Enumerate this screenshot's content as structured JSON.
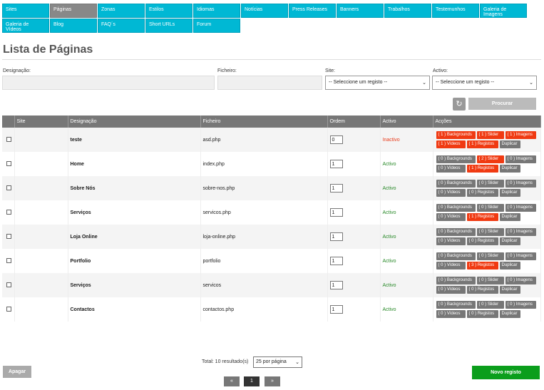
{
  "nav": {
    "tabs": [
      {
        "label": "Sites",
        "active": false
      },
      {
        "label": "Páginas",
        "active": true
      },
      {
        "label": "Zonas",
        "active": false
      },
      {
        "label": "Estilos",
        "active": false
      },
      {
        "label": "Idiomas",
        "active": false
      },
      {
        "label": "Notícias",
        "active": false
      },
      {
        "label": "Press Releases",
        "active": false
      },
      {
        "label": "Banners",
        "active": false
      },
      {
        "label": "Trabalhos",
        "active": false
      },
      {
        "label": "Testemunhos",
        "active": false
      },
      {
        "label": "Galeria de Imagens",
        "active": false
      },
      {
        "label": "Galeria de Vídeos",
        "active": false
      },
      {
        "label": "Blog",
        "active": false
      },
      {
        "label": "FAQ´s",
        "active": false
      },
      {
        "label": "Short URLs",
        "active": false
      },
      {
        "label": "Forum",
        "active": false
      }
    ]
  },
  "page_title": "Lista de Páginas",
  "filters": {
    "designacao_label": "Designação:",
    "ficheiro_label": "Ficheiro:",
    "site_label": "Site:",
    "site_value": "-- Seleccione um registo --",
    "activo_label": "Activo:",
    "activo_value": "-- Seleccione um registo --",
    "procurar_label": "Procurar"
  },
  "table": {
    "headers": [
      "Site",
      "Designação",
      "Ficheiro",
      "Ordem",
      "Activo",
      "Acções"
    ],
    "rows": [
      {
        "designacao": "teste",
        "ficheiro": "asd.php",
        "ordem": "0",
        "activo": "Inactivo",
        "inactive": true,
        "backgrounds": "( 1 ) Backgrounds",
        "backgrounds_red": true,
        "slider": "( 1 ) Slider",
        "slider_red": true,
        "imagens": "( 1 ) Imagens",
        "imagens_red": true,
        "videos": "( 1 ) Vídeos",
        "videos_red": true,
        "registos": "( 1 ) Registos",
        "registos_red": true
      },
      {
        "designacao": "Home",
        "ficheiro": "index.php",
        "ordem": "1",
        "activo": "Activo",
        "inactive": false,
        "backgrounds": "( 0 ) Backgrounds",
        "backgrounds_red": false,
        "slider": "( 2 ) Slider",
        "slider_red": true,
        "imagens": "( 0 ) Imagens",
        "imagens_red": false,
        "videos": "( 0 ) Vídeos",
        "videos_red": false,
        "registos": "( 1 ) Registos",
        "registos_red": true
      },
      {
        "designacao": "Sobre Nós",
        "ficheiro": "sobre-nos.php",
        "ordem": "1",
        "activo": "Activo",
        "inactive": false,
        "backgrounds": "( 0 ) Backgrounds",
        "backgrounds_red": false,
        "slider": "( 0 ) Slider",
        "slider_red": false,
        "imagens": "( 0 ) Imagens",
        "imagens_red": false,
        "videos": "( 0 ) Vídeos",
        "videos_red": false,
        "registos": "( 0 ) Registos",
        "registos_red": false
      },
      {
        "designacao": "Serviços",
        "ficheiro": "servicos.php",
        "ordem": "1",
        "activo": "Activo",
        "inactive": false,
        "backgrounds": "( 0 ) Backgrounds",
        "backgrounds_red": false,
        "slider": "( 0 ) Slider",
        "slider_red": false,
        "imagens": "( 0 ) Imagens",
        "imagens_red": false,
        "videos": "( 0 ) Vídeos",
        "videos_red": false,
        "registos": "( 1 ) Registos",
        "registos_red": true
      },
      {
        "designacao": "Loja Online",
        "ficheiro": "loja-online.php",
        "ordem": "1",
        "activo": "Activo",
        "inactive": false,
        "backgrounds": "( 0 ) Backgrounds",
        "backgrounds_red": false,
        "slider": "( 0 ) Slider",
        "slider_red": false,
        "imagens": "( 0 ) Imagens",
        "imagens_red": false,
        "videos": "( 0 ) Vídeos",
        "videos_red": false,
        "registos": "( 0 ) Registos",
        "registos_red": false
      },
      {
        "designacao": "Portfolio",
        "ficheiro": "portfolio",
        "ordem": "1",
        "activo": "Activo",
        "inactive": false,
        "backgrounds": "( 0 ) Backgrounds",
        "backgrounds_red": false,
        "slider": "( 0 ) Slider",
        "slider_red": false,
        "imagens": "( 0 ) Imagens",
        "imagens_red": false,
        "videos": "( 0 ) Vídeos",
        "videos_red": false,
        "registos": "( 3 ) Registos",
        "registos_red": true
      },
      {
        "designacao": "Serviços",
        "ficheiro": "servicos",
        "ordem": "1",
        "activo": "Activo",
        "inactive": false,
        "backgrounds": "( 0 ) Backgrounds",
        "backgrounds_red": false,
        "slider": "( 0 ) Slider",
        "slider_red": false,
        "imagens": "( 0 ) Imagens",
        "imagens_red": false,
        "videos": "( 0 ) Vídeos",
        "videos_red": false,
        "registos": "( 0 ) Registos",
        "registos_red": false
      },
      {
        "designacao": "Contactos",
        "ficheiro": "contactos.php",
        "ordem": "1",
        "activo": "Activo",
        "inactive": false,
        "backgrounds": "( 0 ) Backgrounds",
        "backgrounds_red": false,
        "slider": "( 0 ) Slider",
        "slider_red": false,
        "imagens": "( 0 ) Imagens",
        "imagens_red": false,
        "videos": "( 0 ) Vídeos",
        "videos_red": false,
        "registos": "( 0 ) Registos",
        "registos_red": false
      }
    ],
    "duplicar_label": "Duplicar"
  },
  "footer": {
    "total_text": "Total: 10 resultado(s)",
    "per_page": "25 por página",
    "apagar_label": "Apagar",
    "novo_label": "Novo registo",
    "prev_label": "«",
    "current_page": "1",
    "next_label": "»"
  },
  "colors": {
    "tab": "#00b8d4",
    "tab_active": "#888888",
    "red_action": "#f03a12",
    "active_text": "#2a8a2a",
    "inactive_text": "#e83a1a",
    "new_button": "#0b9e1c"
  }
}
